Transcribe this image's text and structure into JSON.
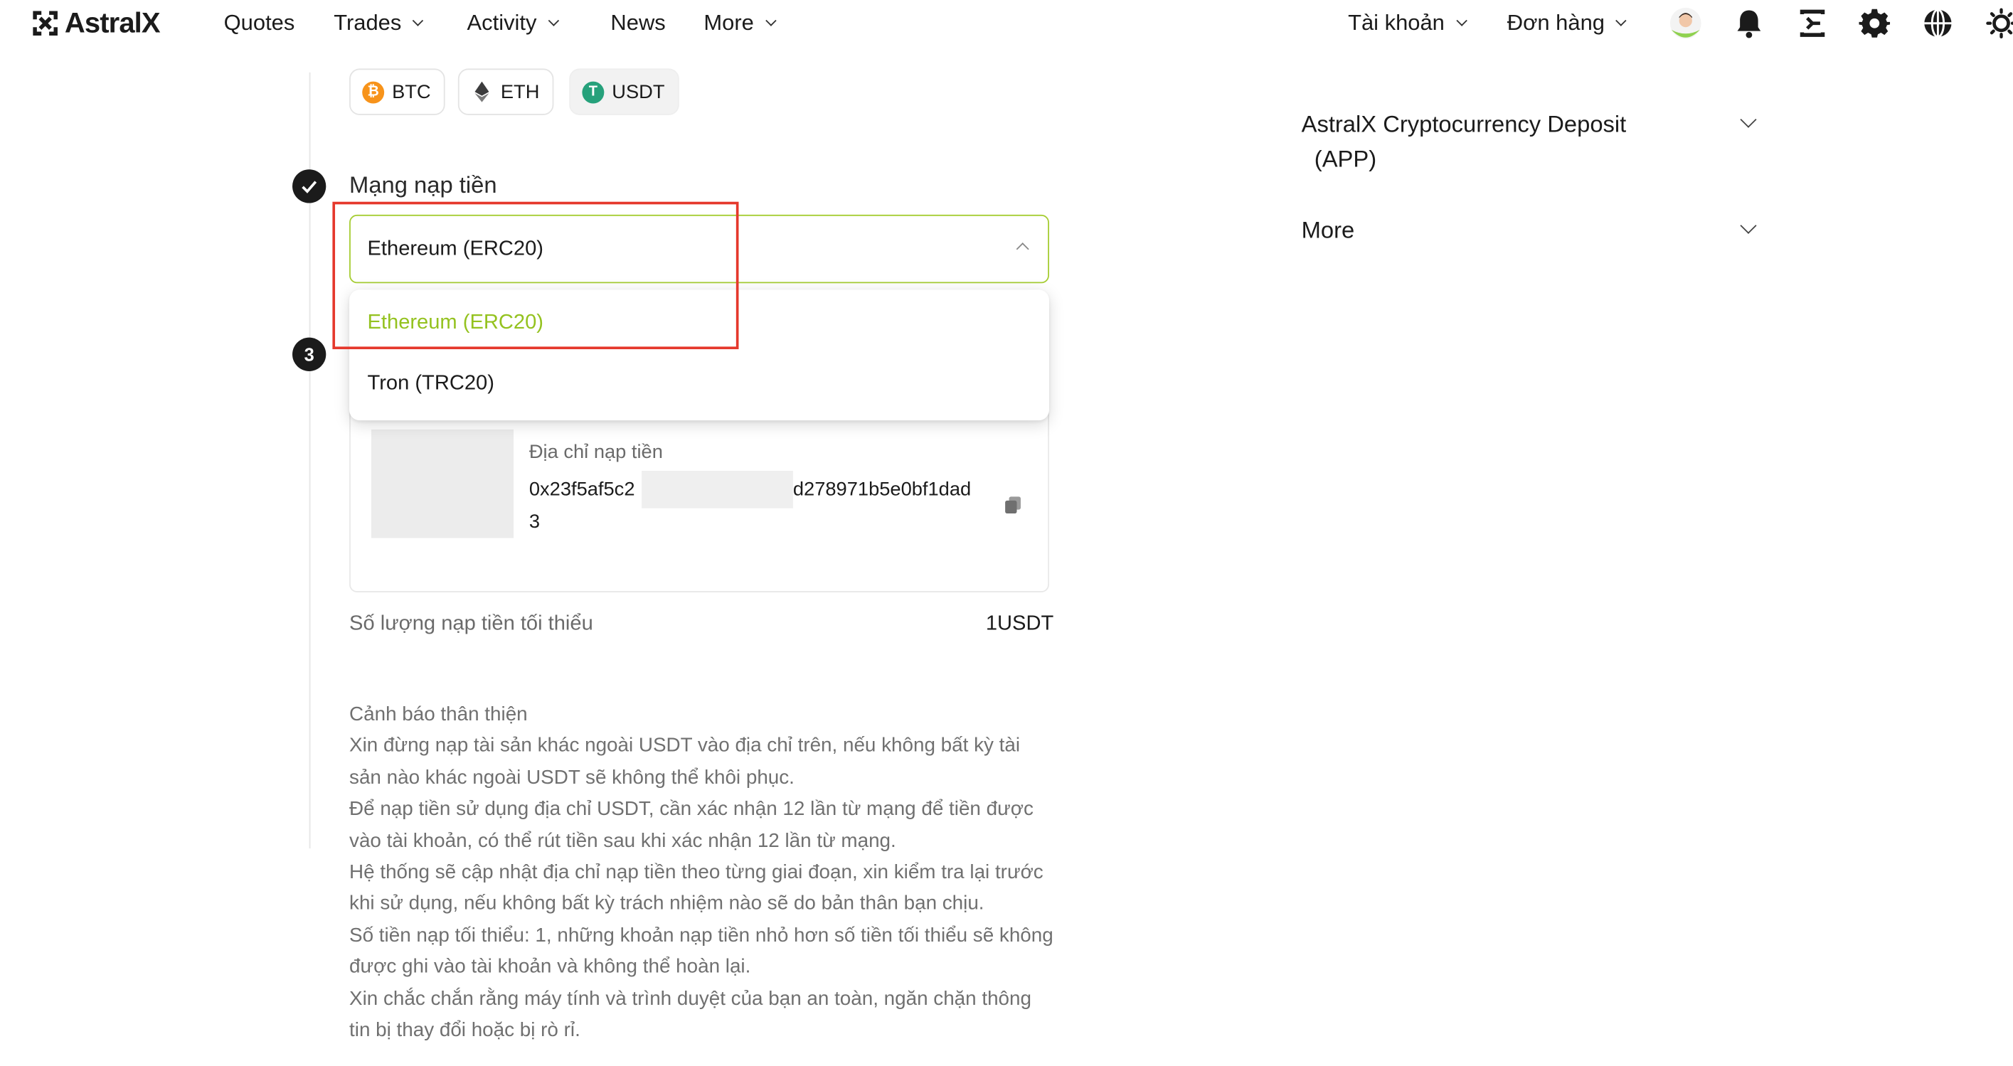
{
  "brand": {
    "name": "AstralX"
  },
  "nav": {
    "quotes": "Quotes",
    "trades": "Trades",
    "activity": "Activity",
    "news": "News",
    "more": "More",
    "account": "Tài khoản",
    "orders": "Đơn hàng"
  },
  "coins": [
    {
      "symbol": "BTC",
      "badge": "₿",
      "color": "#f7931a",
      "selected": false
    },
    {
      "symbol": "ETH",
      "badge": "◆",
      "color": "#3c3c3d",
      "selected": false
    },
    {
      "symbol": "USDT",
      "badge": "T",
      "color": "#26a17b",
      "selected": true
    }
  ],
  "network": {
    "label": "Mạng nạp tiền",
    "selected": "Ethereum (ERC20)",
    "options": [
      "Ethereum (ERC20)",
      "Tron (TRC20)"
    ]
  },
  "step3": {
    "number": "3"
  },
  "address": {
    "label": "Địa chỉ nạp tiền",
    "part1": "0x23f5af5c2",
    "part2": "d278971b5e0bf1dad",
    "part3": "3"
  },
  "minimum": {
    "label": "Số lượng nạp tiền tối thiểu",
    "value": "1USDT"
  },
  "warning": {
    "title": "Cảnh báo thân thiện",
    "lines": [
      "Xin đừng nạp tài sản khác ngoài USDT vào địa chỉ trên, nếu không bất kỳ tài sản nào khác ngoài USDT sẽ không thể khôi phục.",
      "Để nạp tiền sử dụng địa chỉ USDT, cần xác nhận 12 lần từ mạng để tiền được vào tài khoản, có thể rút tiền sau khi xác nhận 12 lần từ mạng.",
      "Hệ thống sẽ cập nhật địa chỉ nạp tiền theo từng giai đoạn, xin kiểm tra lại trước khi sử dụng, nếu không bất kỳ trách nhiệm nào sẽ do bản thân bạn chịu.",
      "Số tiền nạp tối thiểu: 1, những khoản nạp tiền nhỏ hơn số tiền tối thiểu sẽ không được ghi vào tài khoản và không thể hoàn lại.",
      "Xin chắc chắn rằng máy tính và trình duyệt của bạn an toàn, ngăn chặn thông tin bị thay đổi hoặc bị rò rỉ."
    ]
  },
  "sidebar": {
    "faq1_line1": "AstralX Cryptocurrency Deposit",
    "faq1_line2": "(APP)",
    "faq2": "More"
  },
  "colors": {
    "accent": "#a6cd33",
    "highlight_box": "#e5382c"
  },
  "icons": [
    "avatar",
    "bell-icon",
    "download-icon",
    "gear-icon",
    "globe-icon",
    "theme-sun-icon",
    "copy-icon",
    "check-icon"
  ]
}
